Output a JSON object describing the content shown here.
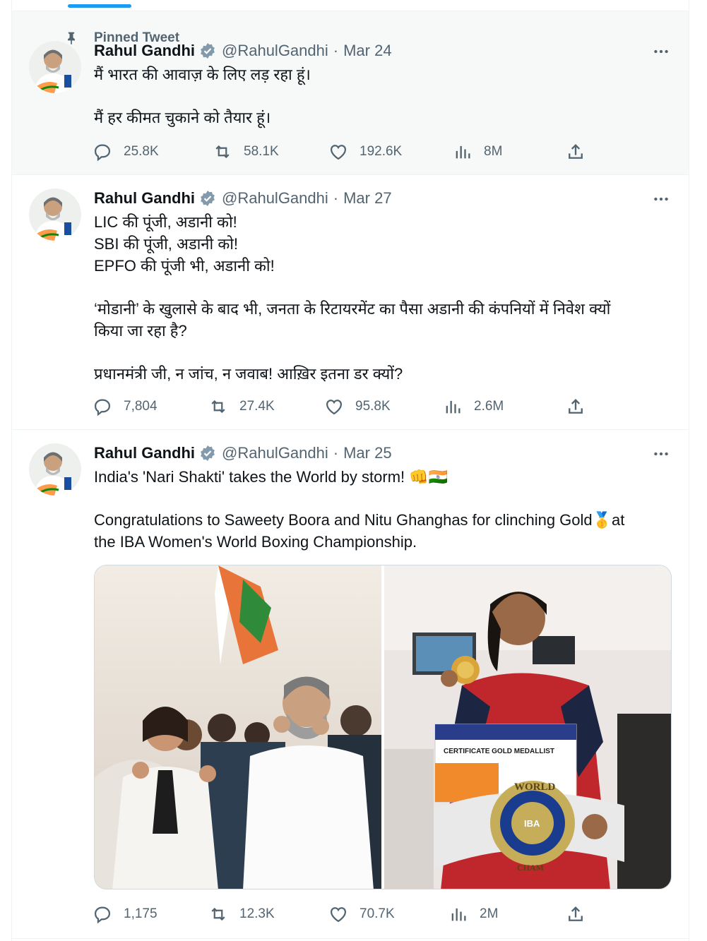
{
  "pinned_label": "Pinned Tweet",
  "tweets": [
    {
      "name": "Rahul Gandhi",
      "handle": "@RahulGandhi",
      "sep": "·",
      "date": "Mar 24",
      "lines": [
        "मैं भारत की आवाज़ के लिए लड़ रहा हूं।",
        "",
        "मैं हर कीमत चुकाने को तैयार हूं।"
      ],
      "stats": {
        "replies": "25.8K",
        "retweets": "58.1K",
        "likes": "192.6K",
        "views": "8M"
      }
    },
    {
      "name": "Rahul Gandhi",
      "handle": "@RahulGandhi",
      "sep": "·",
      "date": "Mar 27",
      "lines": [
        "LIC की पूंजी, अडानी को!",
        "SBI की पूंजी, अडानी को!",
        "EPFO की पूंजी भी, अडानी को!",
        "",
        "‘मोडानी’ के खुलासे के बाद भी, जनता के रिटायरमेंट का पैसा अडानी की कंपनियों में निवेश क्यों",
        "किया जा रहा है?",
        "",
        "प्रधानमंत्री जी, न जांच, न जवाब! आख़िर इतना डर क्यों?"
      ],
      "stats": {
        "replies": "7,804",
        "retweets": "27.4K",
        "likes": "95.8K",
        "views": "2.6M"
      }
    },
    {
      "name": "Rahul Gandhi",
      "handle": "@RahulGandhi",
      "sep": "·",
      "date": "Mar 25",
      "lines": [
        "India's 'Nari Shakti' takes the World by storm! 👊🇮🇳",
        "",
        "Congratulations to Saweety Boora and Nitu Ghanghas for clinching Gold🥇at",
        "the IBA Women's World Boxing Championship."
      ],
      "stats": {
        "replies": "1,175",
        "retweets": "12.3K",
        "likes": "70.7K",
        "views": "2M"
      },
      "photos": [
        {
          "signs": [
            "CERTIFICATE GOLD MEDALLIST"
          ]
        },
        {
          "signs": [
            "CERTIFICATE GOLD MEDALLIST",
            "WORLD",
            "IBA",
            "INTERNATIONAL BOXING ASSOCIATION",
            "CHAM"
          ]
        }
      ]
    }
  ],
  "icons": {
    "pin": "pin-icon",
    "verified": "verified-badge-icon",
    "more": "more-icon",
    "reply": "reply-icon",
    "retweet": "retweet-icon",
    "like": "like-icon",
    "views": "views-icon",
    "share": "share-icon"
  },
  "colors": {
    "accent": "#1d9bf0",
    "text": "#0f1419",
    "secondary": "#536471",
    "pinned_bg": "#f7f9f9"
  }
}
